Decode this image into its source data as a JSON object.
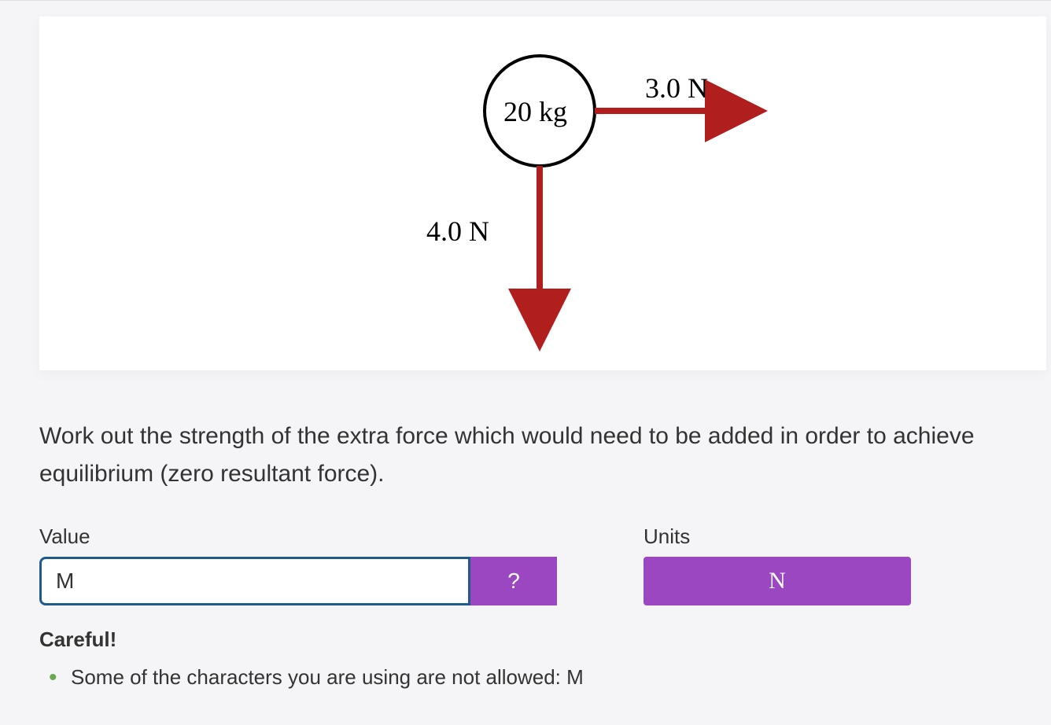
{
  "diagram": {
    "mass_label": "20 kg",
    "force_right": {
      "label": "3.0 N",
      "magnitude_N": 3.0,
      "direction": "right"
    },
    "force_down": {
      "label": "4.0 N",
      "magnitude_N": 4.0,
      "direction": "down"
    },
    "arrow_color": "#b01e1e"
  },
  "question": {
    "text": "Work out the strength of the extra force which would need to be added in order to achieve equilibrium (zero resultant force)."
  },
  "inputs": {
    "value_label": "Value",
    "value_content": "M",
    "help_label": "?",
    "units_label": "Units",
    "units_selected": "N"
  },
  "feedback": {
    "title": "Careful!",
    "items": [
      "Some of the characters you are using are not allowed: M"
    ]
  }
}
